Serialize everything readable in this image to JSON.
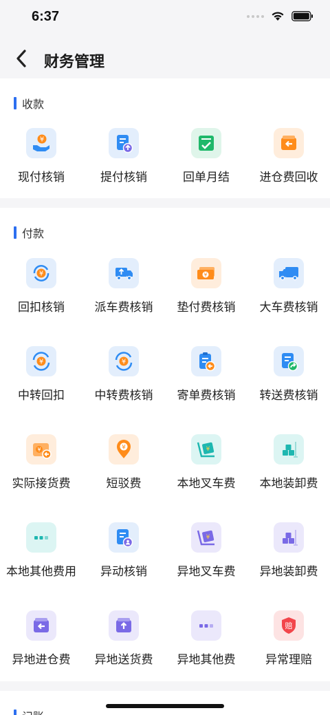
{
  "status": {
    "time": "6:37"
  },
  "nav": {
    "title": "财务管理"
  },
  "sections": [
    {
      "title": "收款",
      "items": [
        {
          "label": "现付核销",
          "icon": "hand-coin-icon"
        },
        {
          "label": "提付核销",
          "icon": "doc-upload-icon"
        },
        {
          "label": "回单月结",
          "icon": "receipt-check-icon"
        },
        {
          "label": "进仓费回收",
          "icon": "wallet-return-icon"
        }
      ]
    },
    {
      "title": "付款",
      "items": [
        {
          "label": "回扣核销",
          "icon": "coin-refresh-icon"
        },
        {
          "label": "派车费核销",
          "icon": "truck-upload-icon"
        },
        {
          "label": "垫付费核销",
          "icon": "money-stack-icon"
        },
        {
          "label": "大车费核销",
          "icon": "truck-icon"
        },
        {
          "label": "中转回扣",
          "icon": "coin-cycle-icon"
        },
        {
          "label": "中转费核销",
          "icon": "coin-cycle-icon"
        },
        {
          "label": "寄单费核销",
          "icon": "clipboard-return-icon"
        },
        {
          "label": "转送费核销",
          "icon": "doc-forward-icon"
        },
        {
          "label": "实际接货费",
          "icon": "wallet-coin-icon"
        },
        {
          "label": "短驳费",
          "icon": "location-coin-icon"
        },
        {
          "label": "本地叉车费",
          "icon": "forklift-icon"
        },
        {
          "label": "本地装卸费",
          "icon": "cargo-boxes-icon"
        },
        {
          "label": "本地其他费用",
          "icon": "more-dots-icon"
        },
        {
          "label": "异动核销",
          "icon": "doc-person-icon"
        },
        {
          "label": "异地叉车费",
          "icon": "forklift-icon"
        },
        {
          "label": "异地装卸费",
          "icon": "cargo-boxes-icon"
        },
        {
          "label": "异地进仓费",
          "icon": "wallet-return-icon"
        },
        {
          "label": "异地送货费",
          "icon": "wallet-upload-icon"
        },
        {
          "label": "异地其他费",
          "icon": "more-dots-icon"
        },
        {
          "label": "异常理赔",
          "icon": "shield-claim-icon"
        }
      ]
    },
    {
      "title": "记账"
    }
  ],
  "colors": {
    "accent": "#2d6ff0",
    "blue_icon": "#2f8cf3",
    "orange_icon": "#ff8c1a",
    "green_icon": "#1fb86a",
    "teal_icon": "#1eb7b0",
    "purple_icon": "#7a6ae6",
    "red_icon": "#f2454b"
  },
  "glyphs": {
    "yuan": "¥",
    "claim": "赔"
  }
}
